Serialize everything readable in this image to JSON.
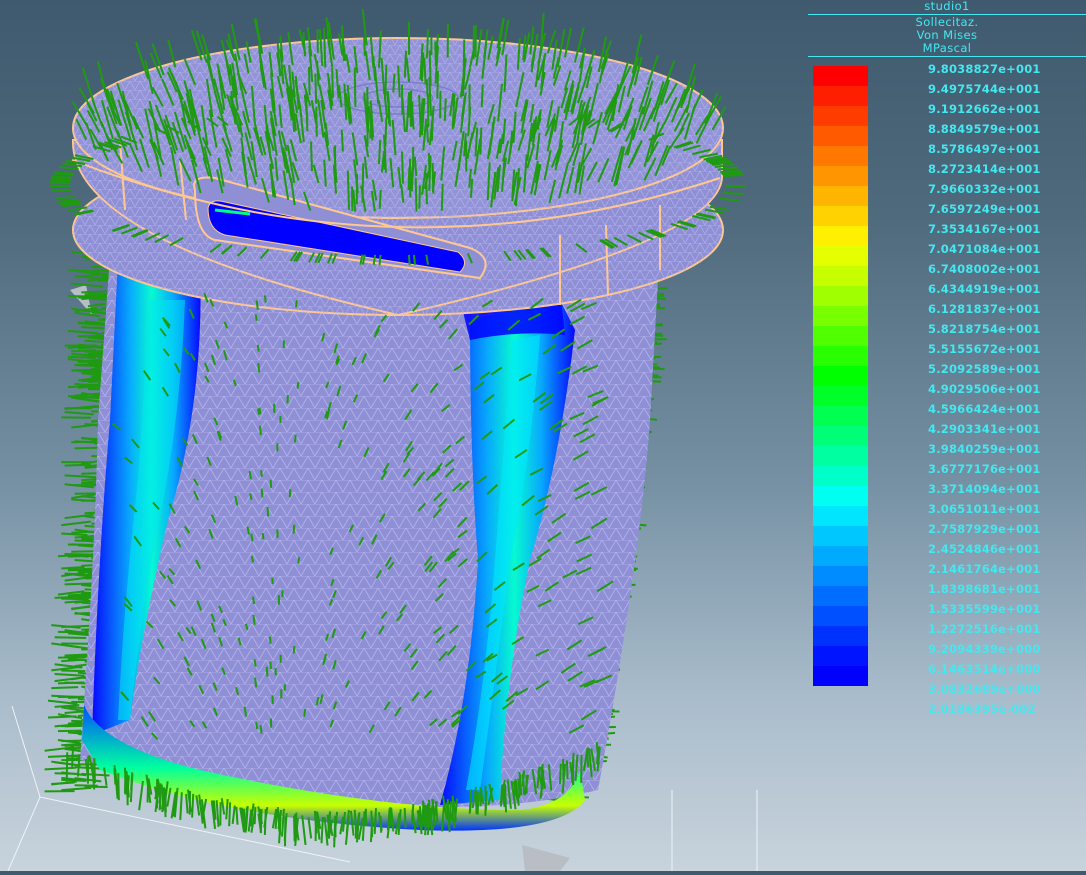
{
  "legend": {
    "analysis_name": "studio1",
    "result_type": "Sollecitaz.",
    "criterion": "Von Mises",
    "unit": "MPascal",
    "colors": [
      "#ff0000",
      "#ff1e00",
      "#ff3c00",
      "#ff5a00",
      "#ff7800",
      "#ff9600",
      "#ffb400",
      "#ffd200",
      "#fff000",
      "#e6ff00",
      "#c8ff00",
      "#a0ff00",
      "#78ff00",
      "#50ff00",
      "#28ff00",
      "#00ff00",
      "#00ff28",
      "#00ff50",
      "#00ff78",
      "#00ffa0",
      "#00ffc8",
      "#00fff0",
      "#00e6ff",
      "#00c8ff",
      "#00aaff",
      "#008cff",
      "#006eff",
      "#0050ff",
      "#0032ff",
      "#0014ff",
      "#0000ff"
    ],
    "ticks": [
      "9.8038827e+001",
      "9.4975744e+001",
      "9.1912662e+001",
      "8.8849579e+001",
      "8.5786497e+001",
      "8.2723414e+001",
      "7.9660332e+001",
      "7.6597249e+001",
      "7.3534167e+001",
      "7.0471084e+001",
      "6.7408002e+001",
      "6.4344919e+001",
      "6.1281837e+001",
      "5.8218754e+001",
      "5.5155672e+001",
      "5.2092589e+001",
      "4.9029506e+001",
      "4.5966424e+001",
      "4.2903341e+001",
      "3.9840259e+001",
      "3.6777176e+001",
      "3.3714094e+001",
      "3.0651011e+001",
      "2.7587929e+001",
      "2.4524846e+001",
      "2.1461764e+001",
      "1.8398681e+001",
      "1.5335599e+001",
      "1.2272516e+001",
      "9.2094339e+000",
      "6.1463514e+000",
      "3.0832689e+000",
      "2.0186395e-002"
    ]
  },
  "scene": {
    "model_color": "#8f8fd6",
    "mesh_color": "#b4b4ec",
    "edge_color": "#ffc890",
    "vector_color": "#1f9a12",
    "low_stress_color": "#0000ff"
  }
}
